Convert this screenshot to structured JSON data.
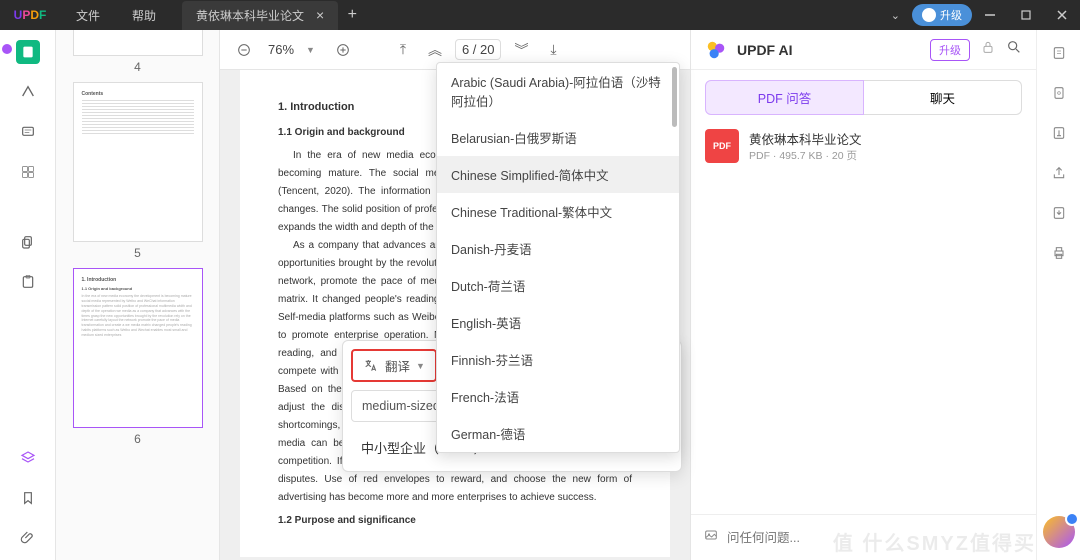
{
  "titlebar": {
    "logo": "UPDF",
    "menus": [
      "文件",
      "帮助"
    ],
    "tab_title": "黄依琳本科毕业论文",
    "upgrade": "升级"
  },
  "toolbar": {
    "zoom": "76%",
    "page_current": "6",
    "page_total": "20",
    "page_display": "6  /  20"
  },
  "thumbs": {
    "nums": [
      "4",
      "5",
      "6"
    ]
  },
  "document": {
    "h1": "1.  Introduction",
    "h2": "1.1  Origin  and  background",
    "p1": "In the era of new media economy, the development of \"we media\" is becoming mature. The social media represented by Weibo and WeChat (Tencent, 2020). The information transmission pattern has undergone great changes. The solid position of professional multimedia has been shaken, which expands the width and depth of the operation of \"We media\".",
    "p2": "As a company that advances and advances with the times, grasp the new opportunities brought by the revolution, rely on the Internet, carefully layout the network, promote the pace of media transformation, and create a we-media matrix. It changed people's reading habits and created new ways of reading. Self-media platforms such as Weibo and Wechat can be used as effective way to promote enterprise operation. New media has changed people's way of reading, and it also enables most small and medium-sized enterprises to compete with large ones, and other media, with low cost and high efficiency. Based on the feedback of consumers (Bo & Wang, 2005). Enterprises can adjust the distribution of products and services to complement their own shortcomings, do proper marketing planning, and give a thumb up. And we media can be a promotion, but it is easy to cause plagiarism and unfair competition. If the enterprises do not handle it well, troubles, such as legal disputes. Use of red envelopes to reward, and choose the new form of advertising has become more and more enterprises to achieve success.",
    "h3": "1.2 Purpose and significance"
  },
  "languages": [
    "Arabic (Saudi Arabia)-阿拉伯语（沙特阿拉伯）",
    "Belarusian-白俄罗斯语",
    "Chinese Simplified-简体中文",
    "Chinese Traditional-繁体中文",
    "Danish-丹麦语",
    "Dutch-荷兰语",
    "English-英语",
    "Finnish-芬兰语",
    "French-法语",
    "German-德语"
  ],
  "translate": {
    "button": "翻译",
    "target_lang": "Chinese Simplified-简体中文",
    "source_text": "medium-sized enterprises (smes)",
    "result_text": "中小型企业（SMEs）"
  },
  "ai": {
    "title": "UPDF AI",
    "upgrade": "升级",
    "tabs": [
      "PDF 问答",
      "聊天"
    ],
    "file_badge": "PDF",
    "file_name": "黄依琳本科毕业论文",
    "file_meta": "PDF · 495.7 KB · 20 页",
    "input_placeholder": "问任何问题..."
  },
  "watermark": "值   什么SMYZ值得买"
}
